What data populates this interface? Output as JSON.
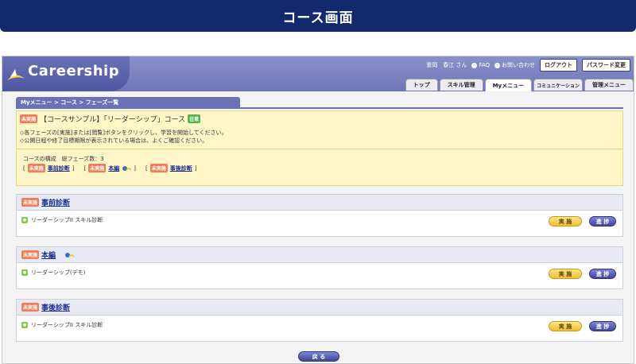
{
  "caption": "コース画面",
  "header": {
    "logo_text": "Careership",
    "user_name": "重岡　春江 さん",
    "faq_label": "FAQ",
    "contact_label": "お問い合わせ",
    "logout_label": "ログアウト",
    "password_label": "パスワード変更"
  },
  "tabs": [
    {
      "label": "トップ"
    },
    {
      "label": "スキル管理"
    },
    {
      "label": "Myメニュー",
      "active": true
    },
    {
      "label": "コミュニケーション"
    },
    {
      "label": "管理メニュー"
    }
  ],
  "breadcrumb": "Myメニュー > コース > フェーズ一覧",
  "course": {
    "status_badge": "未実施",
    "title": "【コースサンプル】「リーダーシップ」コース",
    "tag_badge": "任意",
    "info_line1": "◇各フェーズの[実施]または[閲覧]ボタンをクリックし、学習を開始してください。",
    "info_line2": "◇公開日程や修了目標期限が表示されている場合は、よくご確認ください。",
    "structure_text": "コースの構成　総フェーズ数：3",
    "phase_links": [
      {
        "badge": "未実施",
        "label": "事前診断"
      },
      {
        "badge": "未実施",
        "label": "本編"
      },
      {
        "badge": "未実施",
        "label": "事後診断"
      }
    ]
  },
  "phases": [
    {
      "badge": "未実施",
      "title": "事前診断",
      "item": "リーダーシップII スキル診断",
      "exec_label": "実 施",
      "progress_label": "進 捗"
    },
    {
      "badge": "未実施",
      "title": "本編",
      "item": "リーダーシップ(デモ)",
      "exec_label": "実 施",
      "progress_label": "進 捗"
    },
    {
      "badge": "未実施",
      "title": "事後診断",
      "item": "リーダーシップII スキル診断",
      "exec_label": "実 施",
      "progress_label": "進 捗"
    }
  ],
  "back_label": "戻 る",
  "colors": {
    "caption_bg": "#13296b",
    "header_bg": "#6f76b8",
    "accent_yellow": "#f0c030",
    "status_red": "#ef7d57"
  }
}
